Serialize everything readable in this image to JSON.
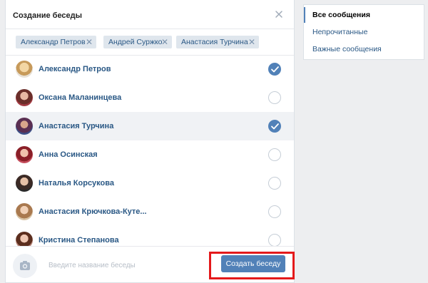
{
  "dialog": {
    "title": "Создание беседы",
    "chips": [
      "Александр Петров",
      "Андрей Суржко",
      "Анастасия Турчина"
    ],
    "contacts": [
      {
        "name": "Александр Петров",
        "checked": true
      },
      {
        "name": "Оксана Маланинцева",
        "checked": false
      },
      {
        "name": "Анастасия Турчина",
        "checked": true
      },
      {
        "name": "Анна Осинская",
        "checked": false
      },
      {
        "name": "Наталья Корсукова",
        "checked": false
      },
      {
        "name": "Анастасия Крючкова-Куте...",
        "checked": false
      },
      {
        "name": "Кристина Степанова",
        "checked": false
      }
    ],
    "name_placeholder": "Введите название беседы",
    "create_label": "Создать беседу"
  },
  "sidebar": {
    "items": [
      {
        "label": "Все сообщения",
        "active": true
      },
      {
        "label": "Непрочитанные",
        "active": false
      },
      {
        "label": "Важные сообщения",
        "active": false
      }
    ]
  },
  "colors": {
    "accent": "#5181b8",
    "link": "#2a5885",
    "highlight": "#e4191b",
    "background": "#edeef0"
  }
}
